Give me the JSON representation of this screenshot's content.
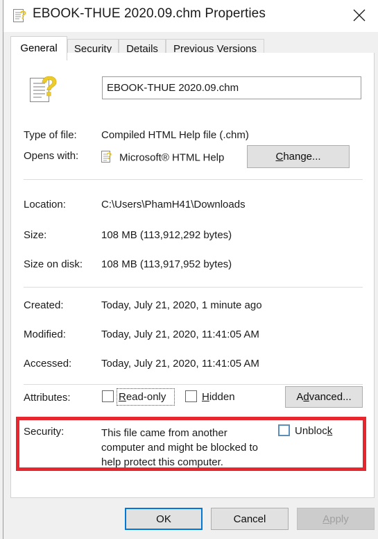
{
  "window": {
    "title": "EBOOK-THUE 2020.09.chm Properties",
    "icon": "chm-help-file-icon",
    "close_label": "×"
  },
  "tabs": [
    {
      "label": "General",
      "active": true
    },
    {
      "label": "Security",
      "active": false
    },
    {
      "label": "Details",
      "active": false
    },
    {
      "label": "Previous Versions",
      "active": false
    }
  ],
  "general": {
    "filename": "EBOOK-THUE 2020.09.chm",
    "rows": [
      {
        "label": "Type of file:",
        "value": "Compiled HTML Help file (.chm)"
      },
      {
        "label": "Opens with:",
        "value": "Microsoft® HTML Help"
      },
      {
        "label": "Location:",
        "value": "C:\\Users\\PhamH41\\Downloads"
      },
      {
        "label": "Size:",
        "value": "108 MB (113,912,292 bytes)"
      },
      {
        "label": "Size on disk:",
        "value": "108 MB (113,917,952 bytes)"
      },
      {
        "label": "Created:",
        "value": "Today, July 21, 2020, 1 minute ago"
      },
      {
        "label": "Modified:",
        "value": "Today, July 21, 2020, 11:41:05 AM"
      },
      {
        "label": "Accessed:",
        "value": "Today, July 21, 2020, 11:41:05 AM"
      },
      {
        "label": "Attributes:",
        "value": ""
      },
      {
        "label": "Security:",
        "value": ""
      }
    ],
    "change_button": "Change...",
    "attributes": {
      "readonly_label": "Read-only",
      "readonly_checked": false,
      "hidden_label": "Hidden",
      "hidden_checked": false,
      "advanced_button": "Advanced..."
    },
    "security": {
      "message": "This file came from another computer and might be blocked to help protect this computer.",
      "unblock_label": "Unblock",
      "unblock_checked": false,
      "highlight_color": "#e8262d"
    }
  },
  "footer": {
    "ok": "OK",
    "cancel": "Cancel",
    "apply": "Apply",
    "apply_disabled": true
  }
}
